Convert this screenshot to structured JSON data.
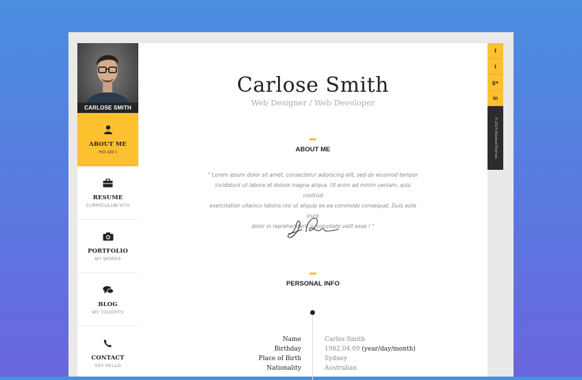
{
  "profile": {
    "name_bar": "CARLOSE SMITH"
  },
  "nav": {
    "items": [
      {
        "label": "ABOUT ME",
        "sub": "HO AM I",
        "icon": "user-icon"
      },
      {
        "label": "RESUME",
        "sub": "CURRICULUM VITA",
        "icon": "briefcase-icon"
      },
      {
        "label": "PORTFOLIO",
        "sub": "MY WORKS",
        "icon": "camera-icon"
      },
      {
        "label": "BLOG",
        "sub": "MY TOUGHTS",
        "icon": "chat-icon"
      },
      {
        "label": "CONTACT",
        "sub": "SAY HELLO",
        "icon": "phone-icon"
      }
    ]
  },
  "header": {
    "title": "Carlose Smith",
    "subtitle": "Web Designer / Web Developer"
  },
  "about": {
    "title": "ABOUT ME",
    "quote_lines": [
      "\" Lorem ipsum dolor sit amet, consectetur adipiscing elit, sed do eiusmod tempor",
      "incididunt ut labore et dolore magna aliqua. Ut enim ad minim veniam, quis nostrud",
      "exercitation ullamco laboris nisi ut aliquip ex ea commodo consequat. Duis aute irure",
      "dolor in reprehenderit in voluptate velit esse ! \""
    ]
  },
  "personal": {
    "title": "PERSONAL INFO",
    "rows": [
      {
        "key": "Name",
        "value": "Carlos Smith",
        "extra": ""
      },
      {
        "key": "Birthday",
        "value": "1982.04.09",
        "extra": " (year/day/month)"
      },
      {
        "key": "Place of Birth",
        "value": "Sydney",
        "extra": ""
      },
      {
        "key": "Nationality",
        "value": "Australian",
        "extra": ""
      }
    ]
  },
  "social": {
    "buttons": [
      {
        "label": "f",
        "icon": "facebook-icon"
      },
      {
        "label": "t",
        "icon": "twitter-icon"
      },
      {
        "label": "g+",
        "icon": "google-plus-icon"
      },
      {
        "label": "in",
        "icon": "linkedin-icon"
      }
    ],
    "copyright": "© 2014 MutationThemes."
  },
  "colors": {
    "accent": "#fdc02f",
    "dark": "#2c2c2c"
  }
}
